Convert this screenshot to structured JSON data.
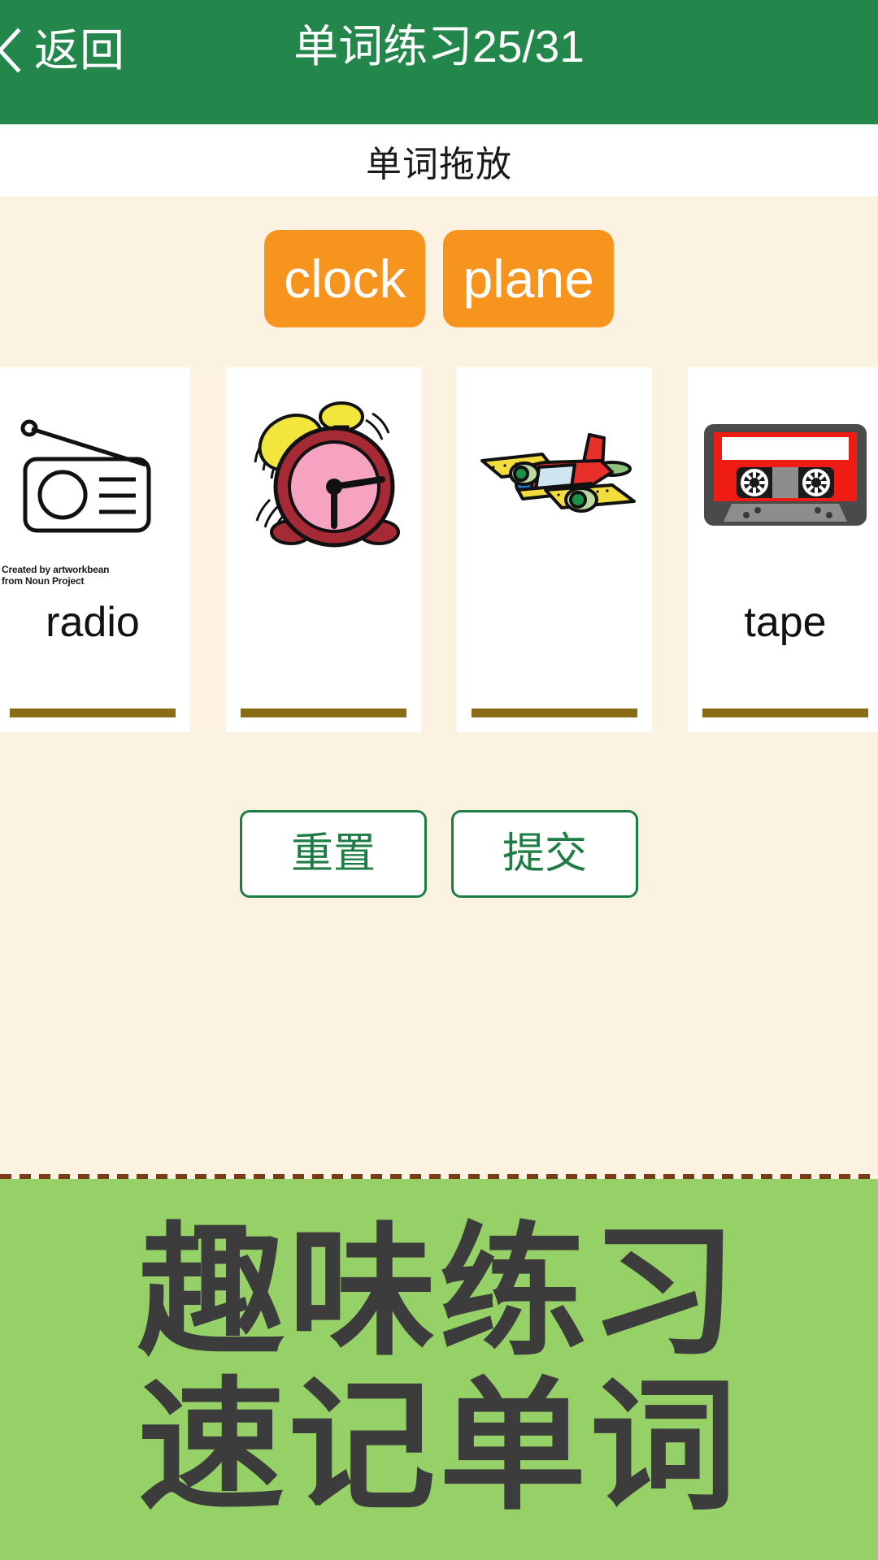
{
  "header": {
    "back_label": "返回",
    "back_icon": "chevron-left-icon",
    "title": "单词练习25/31",
    "bg_color": "#23874c"
  },
  "subtitle": {
    "text": "单词拖放"
  },
  "exercise": {
    "bg_color": "#fbf2e1",
    "word_tiles": [
      {
        "label": "clock",
        "color": "#f7941e"
      },
      {
        "label": "plane",
        "color": "#f7941e"
      }
    ],
    "cards": [
      {
        "icon": "radio-icon",
        "label": "radio",
        "attribution_line1": "Created by artworkbean",
        "attribution_line2": "from Noun Project",
        "filled": true
      },
      {
        "icon": "alarm-clock-icon",
        "label": "",
        "attribution_line1": "",
        "attribution_line2": "",
        "filled": false
      },
      {
        "icon": "airplane-icon",
        "label": "",
        "attribution_line1": "",
        "attribution_line2": "",
        "filled": false
      },
      {
        "icon": "cassette-tape-icon",
        "label": "tape",
        "attribution_line1": "",
        "attribution_line2": "",
        "filled": true
      }
    ],
    "drop_bar_color": "#8a6b16",
    "buttons": {
      "reset_label": "重置",
      "submit_label": "提交",
      "accent_color": "#1d7d45"
    }
  },
  "banner": {
    "line1": "趣味练习",
    "line2": "速记单词",
    "bg_color": "#95d166",
    "text_color": "#3c3c3c"
  }
}
